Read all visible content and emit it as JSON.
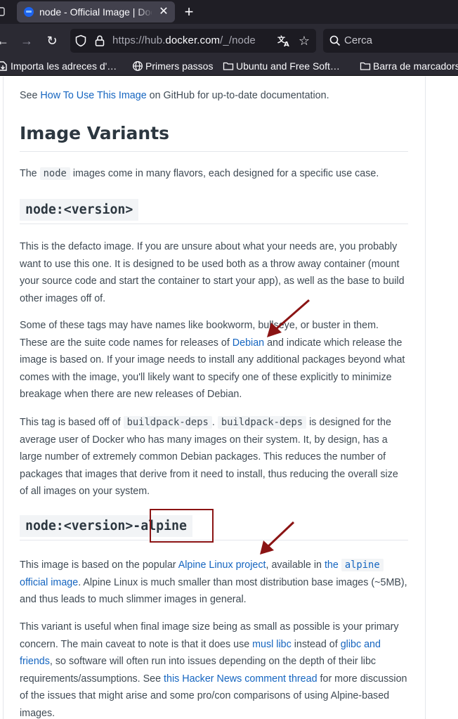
{
  "browser": {
    "tab": {
      "title": "node - Official Image | Docker Hub",
      "close_glyph": "✕"
    },
    "new_tab_glyph": "+",
    "nav": {
      "back_glyph": "←",
      "forward_glyph": "→",
      "reload_glyph": "↻"
    },
    "url": {
      "prefix": "https://hub.",
      "host": "docker.com",
      "path": "/_/node"
    },
    "search": {
      "placeholder": "Cerca"
    },
    "bookmarks": [
      {
        "label": "Importa les adreces d'…",
        "icon": "import-icon"
      },
      {
        "label": "Primers passos",
        "icon": "globe-icon"
      },
      {
        "label": "Ubuntu and Free Soft…",
        "icon": "folder-icon"
      },
      {
        "label": "Barra de marcadors",
        "icon": "folder-icon"
      }
    ]
  },
  "doc": {
    "see_prefix": "See ",
    "see_link": "How To Use This Image",
    "see_suffix": " on GitHub for up-to-date documentation.",
    "variants_heading": "Image Variants",
    "variants_intro_prefix": "The ",
    "variants_intro_code": "node",
    "variants_intro_suffix": " images come in many flavors, each designed for a specific use case.",
    "v1_heading": "node:<version>",
    "v1_p1": "This is the defacto image. If you are unsure about what your needs are, you probably want to use this one. It is designed to be used both as a throw away container (mount your source code and start the container to start your app), as well as the base to build other images off of.",
    "v1_p2_prefix": "Some of these tags may have names like bookworm, bullseye, or buster in them. These are the suite code names for releases of ",
    "v1_p2_link": "Debian",
    "v1_p2_suffix": " and indicate which release the image is based on. If your image needs to install any additional packages beyond what comes with the image, you'll likely want to specify one of these explicitly to minimize breakage when there are new releases of Debian.",
    "v1_p3_prefix": "This tag is based off of ",
    "v1_p3_code1": "buildpack-deps",
    "v1_p3_mid": ". ",
    "v1_p3_code2": "buildpack-deps",
    "v1_p3_suffix": " is designed for the average user of Docker who has many images on their system. It, by design, has a large number of extremely common Debian packages. This reduces the number of packages that images that derive from it need to install, thus reducing the overall size of all images on your system.",
    "v2_heading": "node:<version>-alpine",
    "v2_p1_prefix": "This image is based on the popular ",
    "v2_p1_link1": "Alpine Linux project",
    "v2_p1_mid": ", available in ",
    "v2_p1_link2a": "the ",
    "v2_p1_link2_code": "alpine",
    "v2_p1_link2b": " official image",
    "v2_p1_suffix": ". Alpine Linux is much smaller than most distribution base images (~5MB), and thus leads to much slimmer images in general.",
    "v2_p2_prefix": "This variant is useful when final image size being as small as possible is your primary concern. The main caveat to note is that it does use ",
    "v2_p2_link1": "musl libc",
    "v2_p2_mid1": " instead of ",
    "v2_p2_link2": "glibc and friends",
    "v2_p2_mid2": ", so software will often run into issues depending on the depth of their libc requirements/assumptions. See ",
    "v2_p2_link3": "this Hacker News comment thread",
    "v2_p2_suffix": " for more discussion of the issues that might arise and some pro/con comparisons of using Alpine-based images."
  },
  "colors": {
    "annotation": "#8b1414",
    "link": "#1565c0",
    "text": "#3f4a54"
  }
}
